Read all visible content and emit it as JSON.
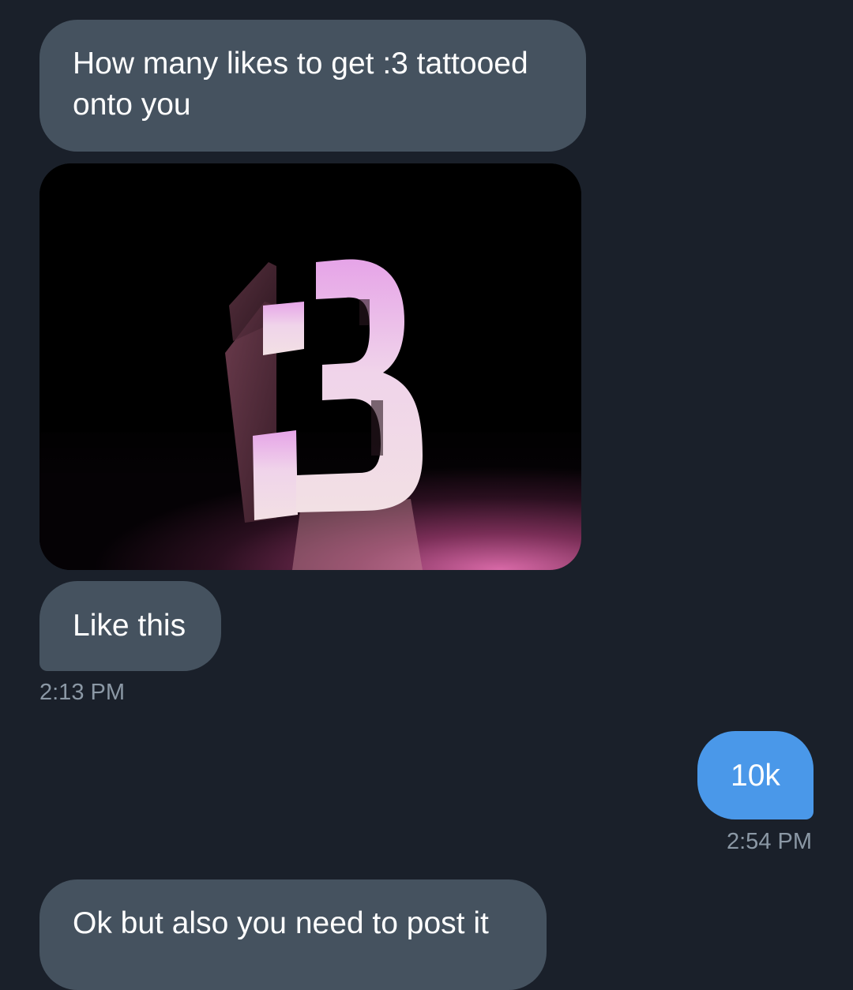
{
  "messages": [
    {
      "direction": "received",
      "text": "How many likes to get :3 tattooed onto you"
    },
    {
      "direction": "received",
      "type": "image",
      "subject": ":3"
    },
    {
      "direction": "received",
      "text": "Like this",
      "timestamp": "2:13 PM"
    },
    {
      "direction": "sent",
      "text": "10k",
      "timestamp": "2:54 PM"
    },
    {
      "direction": "received",
      "text": "Ok but also you need to post it"
    }
  ],
  "colors": {
    "background": "#1a202a",
    "received_bubble": "#45525f",
    "sent_bubble": "#4a98e9",
    "timestamp_text": "#8b98a5"
  }
}
